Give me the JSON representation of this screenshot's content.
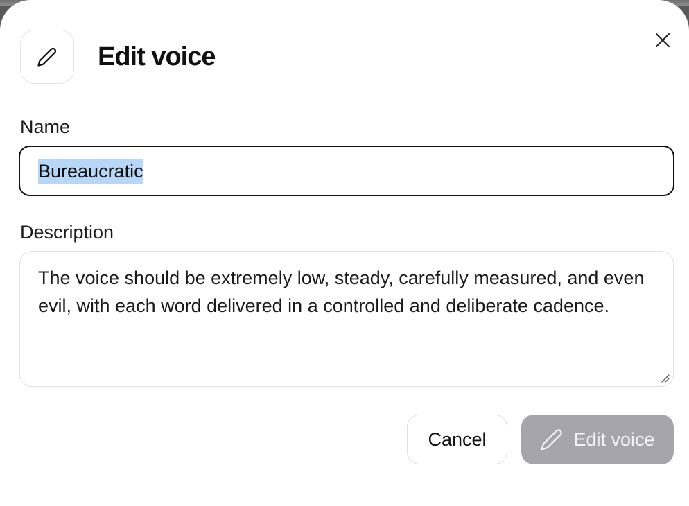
{
  "dialog": {
    "title": "Edit voice",
    "header_icon": "pencil-icon",
    "close_icon": "close-icon"
  },
  "form": {
    "name_label": "Name",
    "name_value": "Bureaucratic",
    "description_label": "Description",
    "description_value": "The voice should be extremely low, steady, carefully measured, and even evil, with each word delivered in a controlled and deliberate cadence."
  },
  "actions": {
    "cancel_label": "Cancel",
    "submit_label": "Edit voice",
    "submit_icon": "pencil-icon",
    "submit_disabled": true
  },
  "colors": {
    "submit_bg": "#a5a5ab",
    "selection": "#b8d6f5",
    "focus_border": "#111111"
  }
}
